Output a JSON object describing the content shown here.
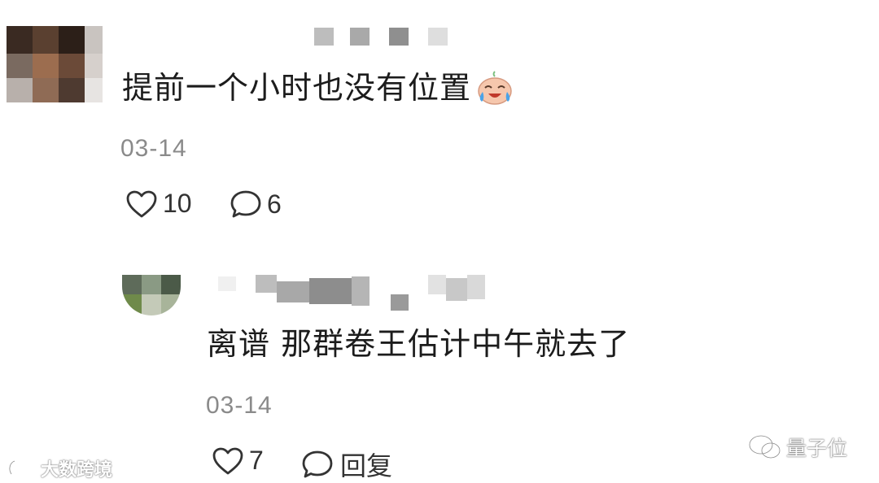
{
  "comment": {
    "text": "提前一个小时也没有位置",
    "emoji": "crying-laughing-face",
    "date": "03-14",
    "likes": "10",
    "replies": "6"
  },
  "reply": {
    "text": "离谱 那群卷王估计中午就去了",
    "date": "03-14",
    "likes": "7",
    "reply_label": "回复"
  },
  "watermarks": {
    "left": "大数跨境",
    "right": "量子位"
  },
  "colors": {
    "text": "#1c1c1c",
    "muted": "#8a8a8a",
    "icon": "#333333"
  }
}
